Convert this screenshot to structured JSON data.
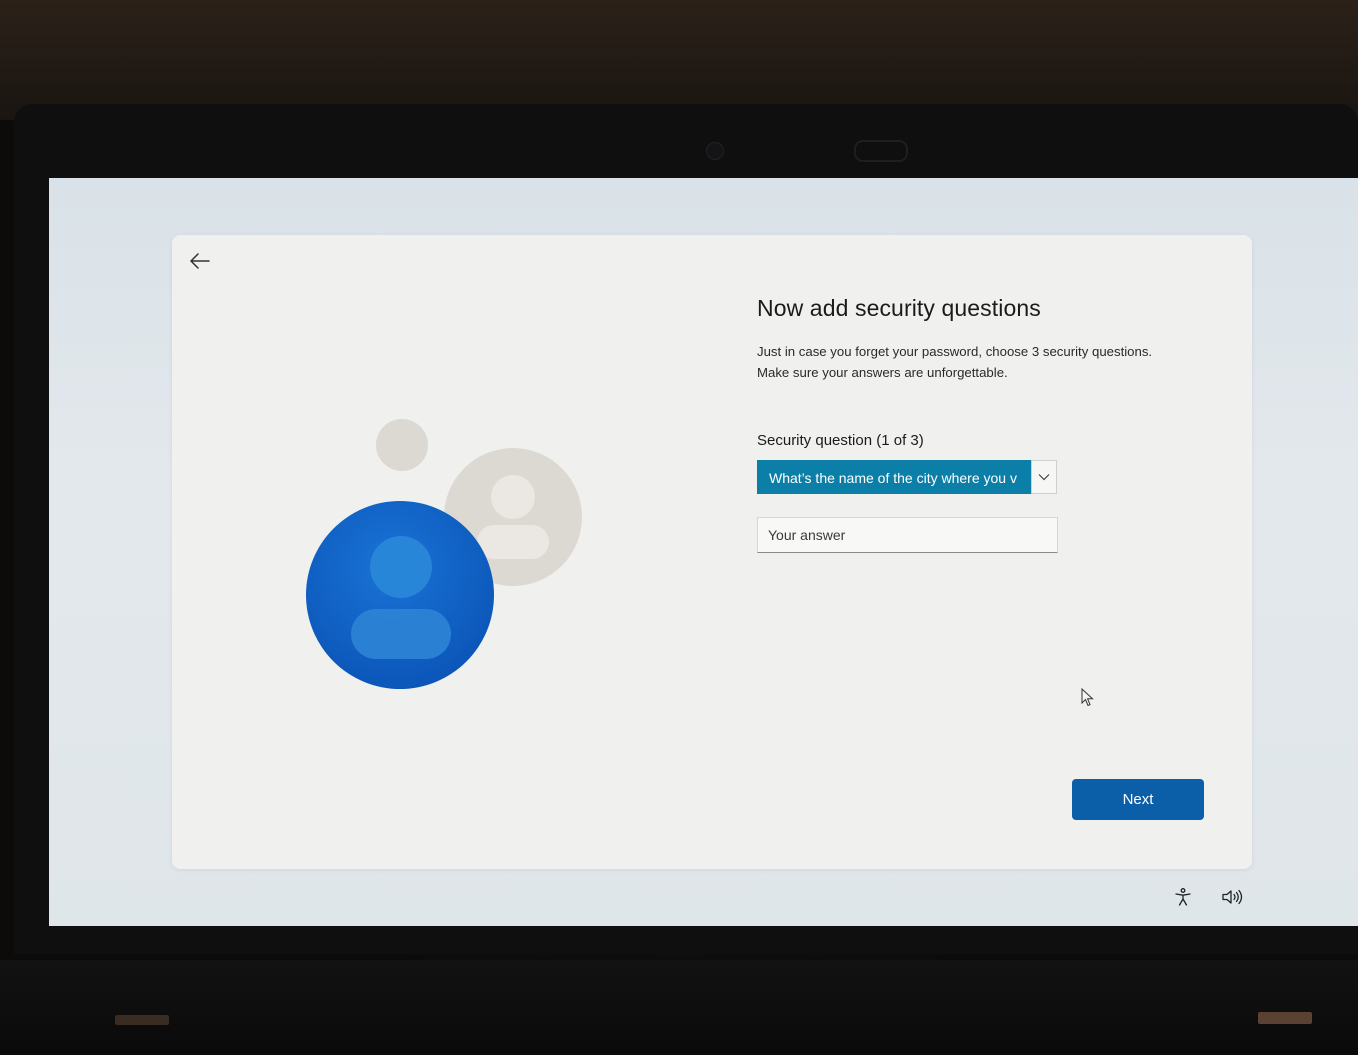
{
  "header": {
    "back_icon": "arrow-left-icon"
  },
  "main": {
    "title": "Now add security questions",
    "description_lines": [
      "Just in case you forget your password, choose 3 security questions.",
      "Make sure your answers are unforgettable."
    ],
    "security_question_label": "Security question (1 of 3)",
    "security_question_selected": "What’s the name of the city where you was born?",
    "security_question_visible": "What’s the name of the city where you v",
    "answer_placeholder": "Your answer",
    "next_label": "Next"
  },
  "tray": {
    "accessibility_icon": "accessibility-icon",
    "volume_icon": "volume-icon"
  },
  "colors": {
    "accent_blue": "#0b5fa8",
    "select_highlight": "#0c7fa8",
    "avatar_primary": "#0e5fc0",
    "avatar_secondary": "#dcd8d2",
    "card_background": "#f0f0ef"
  }
}
